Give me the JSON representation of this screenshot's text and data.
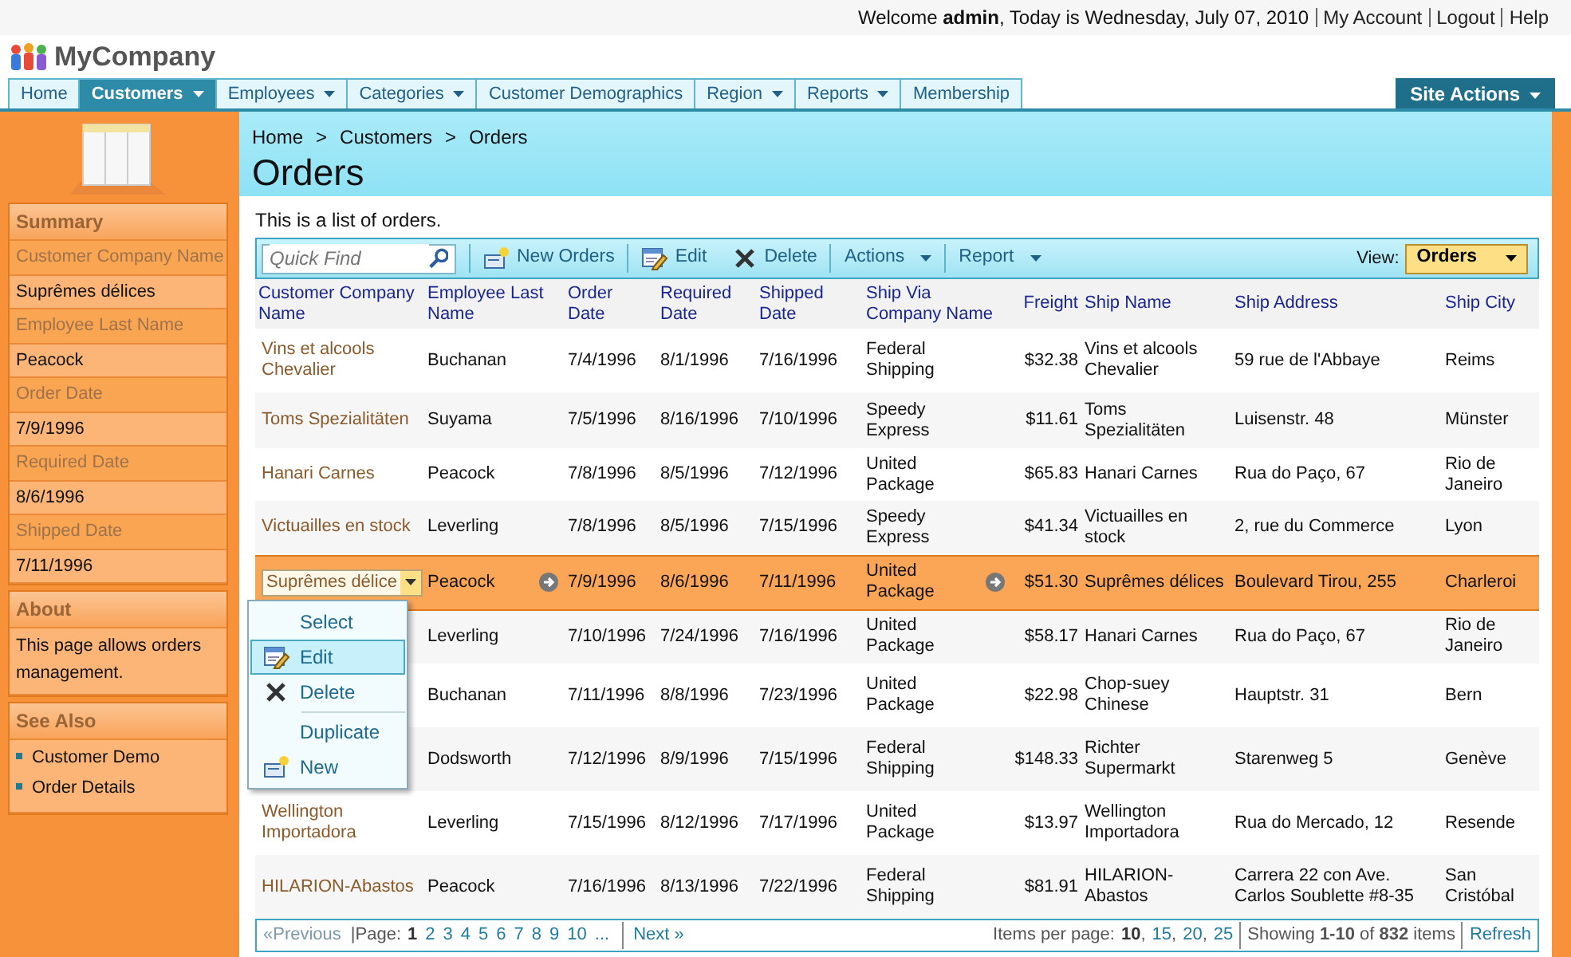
{
  "top_bar": {
    "welcome": "Welcome **admin**, Today is Wednesday, July 07, 2010",
    "links": [
      "My Account",
      "Logout",
      "Help"
    ]
  },
  "logo": {
    "title": "MyCompany"
  },
  "nav": {
    "tabs": [
      {
        "label": "Home",
        "selected": false,
        "has_menu": false
      },
      {
        "label": "Customers",
        "selected": true,
        "has_menu": true
      },
      {
        "label": "Employees",
        "selected": false,
        "has_menu": true
      },
      {
        "label": "Categories",
        "selected": false,
        "has_menu": true
      },
      {
        "label": "Customer Demographics",
        "selected": false,
        "has_menu": false
      },
      {
        "label": "Region",
        "selected": false,
        "has_menu": true
      },
      {
        "label": "Reports",
        "selected": false,
        "has_menu": true
      },
      {
        "label": "Membership",
        "selected": false,
        "has_menu": false
      }
    ],
    "site_actions": "Site Actions"
  },
  "sidebar": {
    "summary": {
      "title": "Summary",
      "fields": [
        {
          "label": "Customer Company Name",
          "value": "Suprêmes délices"
        },
        {
          "label": "Employee Last Name",
          "value": "Peacock"
        },
        {
          "label": "Order Date",
          "value": "7/9/1996"
        },
        {
          "label": "Required Date",
          "value": "8/6/1996"
        },
        {
          "label": "Shipped Date",
          "value": "7/11/1996"
        }
      ]
    },
    "about": {
      "title": "About",
      "text": "This page allows orders management."
    },
    "see_also": {
      "title": "See Also",
      "links": [
        "Customer Demo",
        "Order Details"
      ]
    }
  },
  "header": {
    "breadcrumb": [
      "Home",
      "Customers",
      "Orders"
    ],
    "breadcrumb_separator": ">",
    "title": "Orders"
  },
  "description": "This is a list of orders.",
  "toolbar": {
    "search": {
      "placeholder": "Quick Find"
    },
    "buttons": [
      {
        "label": "New Orders",
        "kind": "new"
      },
      {
        "label": "Edit",
        "kind": "edit"
      },
      {
        "label": "Delete",
        "kind": "delete"
      },
      {
        "label": "Actions",
        "kind": "menu"
      },
      {
        "label": "Report",
        "kind": "menu"
      }
    ],
    "view_label": "View:",
    "view_value": "Orders"
  },
  "table": {
    "columns": [
      "Customer Company Name",
      "Employee Last Name",
      "Order Date",
      "Required Date",
      "Shipped Date",
      "Ship Via Company Name",
      "Freight",
      "Ship Name",
      "Ship Address",
      "Ship City"
    ],
    "rows": [
      {
        "selected": false,
        "cells": [
          "Vins et alcools Chevalier",
          "Buchanan",
          "7/4/1996",
          "8/1/1996",
          "7/16/1996",
          "Federal Shipping",
          "$32.38",
          "Vins et alcools Chevalier",
          "59 rue de l'Abbaye",
          "Reims"
        ]
      },
      {
        "selected": false,
        "cells": [
          "Toms Spezialitäten",
          "Suyama",
          "7/5/1996",
          "8/16/1996",
          "7/10/1996",
          "Speedy Express",
          "$11.61",
          "Toms Spezialitäten",
          "Luisenstr. 48",
          "Münster"
        ]
      },
      {
        "selected": false,
        "cells": [
          "Hanari Carnes",
          "Peacock",
          "7/8/1996",
          "8/5/1996",
          "7/12/1996",
          "United Package",
          "$65.83",
          "Hanari Carnes",
          "Rua do Paço, 67",
          "Rio de Janeiro"
        ]
      },
      {
        "selected": false,
        "cells": [
          "Victuailles en stock",
          "Leverling",
          "7/8/1996",
          "8/5/1996",
          "7/15/1996",
          "Speedy Express",
          "$41.34",
          "Victuailles en stock",
          "2, rue du Commerce",
          "Lyon"
        ]
      },
      {
        "selected": true,
        "cells": [
          "Suprêmes délice",
          "Peacock",
          "7/9/1996",
          "8/6/1996",
          "7/11/1996",
          "United Package",
          "$51.30",
          "Suprêmes délices",
          "Boulevard Tirou, 255",
          "Charleroi"
        ]
      },
      {
        "selected": false,
        "cells": [
          null,
          "Leverling",
          "7/10/1996",
          "7/24/1996",
          "7/16/1996",
          "United Package",
          "$58.17",
          "Hanari Carnes",
          "Rua do Paço, 67",
          "Rio de Janeiro"
        ]
      },
      {
        "selected": false,
        "cells": [
          null,
          "Buchanan",
          "7/11/1996",
          "8/8/1996",
          "7/23/1996",
          "United Package",
          "$22.98",
          "Chop-suey Chinese",
          "Hauptstr. 31",
          "Bern"
        ]
      },
      {
        "selected": false,
        "cells": [
          null,
          "Dodsworth",
          "7/12/1996",
          "8/9/1996",
          "7/15/1996",
          "Federal Shipping",
          "$148.33",
          "Richter Supermarkt",
          "Starenweg 5",
          "Genève"
        ]
      },
      {
        "selected": false,
        "cells": [
          "Wellington Importadora",
          "Leverling",
          "7/15/1996",
          "8/12/1996",
          "7/17/1996",
          "United Package",
          "$13.97",
          "Wellington Importadora",
          "Rua do Mercado, 12",
          "Resende"
        ]
      },
      {
        "selected": false,
        "cells": [
          "HILARION-Abastos",
          "Peacock",
          "7/16/1996",
          "8/13/1996",
          "7/22/1996",
          "Federal Shipping",
          "$81.91",
          "HILARION-Abastos",
          "Carrera 22 con Ave. Carlos Soublette #8-35",
          "San Cristóbal"
        ]
      }
    ]
  },
  "context_menu": {
    "items": [
      {
        "label": "Select",
        "kind": "plain",
        "selected": false
      },
      {
        "label": "Edit",
        "kind": "edit",
        "selected": true
      },
      {
        "label": "Delete",
        "kind": "delete",
        "selected": false
      },
      {
        "kind": "divider"
      },
      {
        "label": "Duplicate",
        "kind": "plain",
        "selected": false
      },
      {
        "label": "New",
        "kind": "new",
        "selected": false
      }
    ]
  },
  "pager": {
    "previous": "«Previous",
    "previous_disabled": true,
    "page_label": "|Page:",
    "pages": [
      {
        "label": "1",
        "selected": true
      },
      {
        "label": "2",
        "selected": false
      },
      {
        "label": "3",
        "selected": false
      },
      {
        "label": "4",
        "selected": false
      },
      {
        "label": "5",
        "selected": false
      },
      {
        "label": "6",
        "selected": false
      },
      {
        "label": "7",
        "selected": false
      },
      {
        "label": "8",
        "selected": false
      },
      {
        "label": "9",
        "selected": false
      },
      {
        "label": "10",
        "selected": false
      }
    ],
    "ellipsis": "...",
    "next": "Next »",
    "items_label": "Items per page:",
    "sizes": [
      {
        "label": "10",
        "selected": true,
        "separator": ","
      },
      {
        "label": "15",
        "selected": false,
        "separator": ","
      },
      {
        "label": "20",
        "selected": false,
        "separator": ","
      },
      {
        "label": "25",
        "selected": false
      }
    ],
    "showing": "Showing **1-10** of **832** items",
    "refresh": "Refresh"
  }
}
